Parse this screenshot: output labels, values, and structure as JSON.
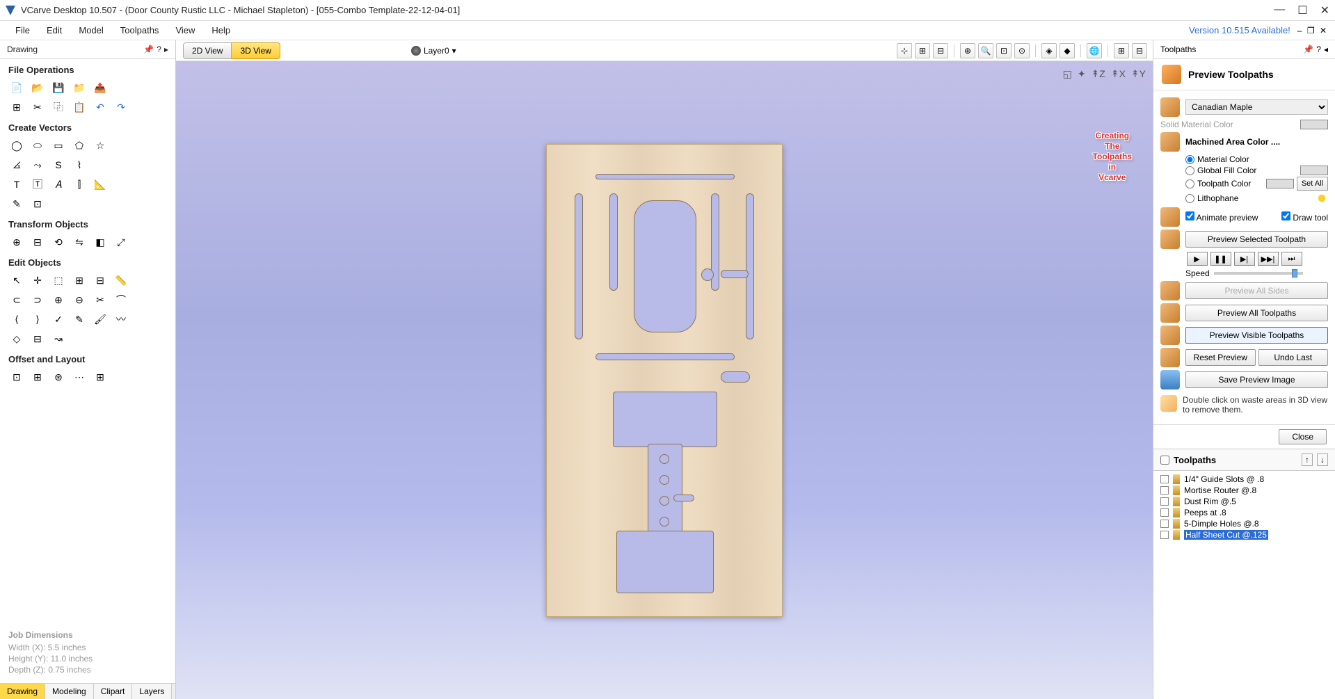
{
  "window": {
    "title": "VCarve Desktop 10.507 - (Door County Rustic LLC - Michael Stapleton) - [055-Combo Template-22-12-04-01]"
  },
  "menu": {
    "items": [
      "File",
      "Edit",
      "Model",
      "Toolpaths",
      "View",
      "Help"
    ],
    "version_notice": "Version 10.515 Available!"
  },
  "left": {
    "panel_title": "Drawing",
    "sections": {
      "file_ops": "File Operations",
      "create_vectors": "Create Vectors",
      "transform": "Transform Objects",
      "edit": "Edit Objects",
      "offset": "Offset and Layout"
    },
    "job_dimensions": {
      "title": "Job Dimensions",
      "width": "Width  (X): 5.5 inches",
      "height": "Height (Y): 11.0 inches",
      "depth": "Depth  (Z): 0.75 inches"
    },
    "tabs": [
      "Drawing",
      "Modeling",
      "Clipart",
      "Layers"
    ]
  },
  "center": {
    "view_tabs": {
      "tab1": "2D View",
      "tab2": "3D View"
    },
    "layer": "Layer0",
    "overlay": {
      "l1": "Creating",
      "l2": "The",
      "l3": "Toolpaths",
      "l4": "in",
      "l5": "Vcarve"
    }
  },
  "right": {
    "panel_title": "Toolpaths",
    "preview_title": "Preview Toolpaths",
    "material": "Canadian Maple",
    "solid_material_label": "Solid Material Color",
    "machined_area_label": "Machined Area Color ....",
    "radios": {
      "material": "Material Color",
      "global": "Global Fill Color",
      "toolpath": "Toolpath Color",
      "litho": "Lithophane"
    },
    "set_all": "Set All",
    "checks": {
      "animate": "Animate preview",
      "draw_tool": "Draw tool"
    },
    "buttons": {
      "preview_selected": "Preview Selected Toolpath",
      "preview_all_sides": "Preview All Sides",
      "preview_all": "Preview All Toolpaths",
      "preview_visible": "Preview Visible Toolpaths",
      "reset": "Reset Preview",
      "undo": "Undo Last",
      "save_image": "Save Preview Image",
      "close": "Close"
    },
    "speed_label": "Speed",
    "hint": "Double click on waste areas in 3D view to remove them.",
    "list_title": "Toolpaths",
    "toolpaths": [
      "1/4\" Guide Slots @ .8",
      "Mortise Router @.8",
      "Dust Rim @.5",
      "Peeps at .8",
      "5-Dimple Holes @.8",
      "Half Sheet Cut @.125"
    ]
  }
}
